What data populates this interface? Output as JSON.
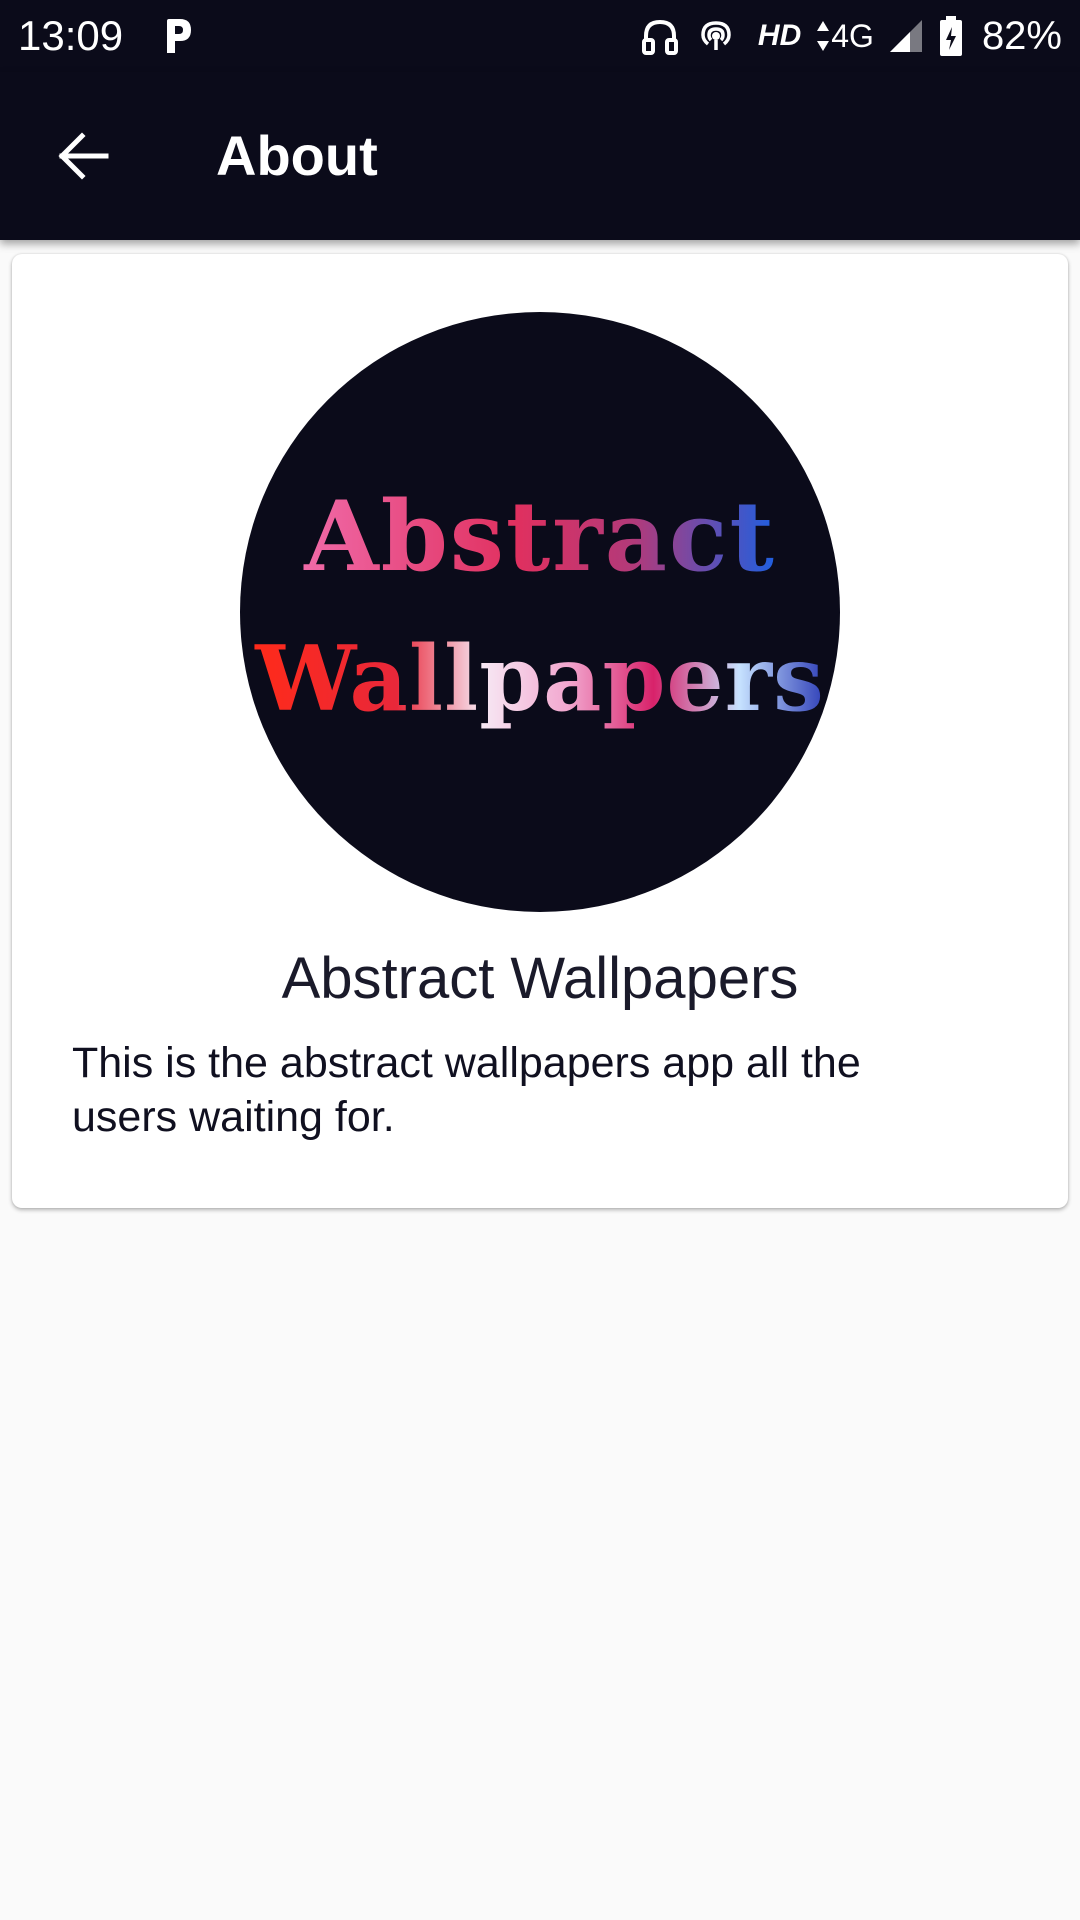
{
  "status_bar": {
    "time": "13:09",
    "network_hd": "HD",
    "network_type": "4G",
    "battery_percent": "82%",
    "icons": [
      "p-notification-icon",
      "headphones-icon",
      "hotspot-icon",
      "data-arrows-icon",
      "signal-icon",
      "battery-charging-icon"
    ]
  },
  "app_bar": {
    "title": "About",
    "back_icon": "arrow-left-icon",
    "background_color": "#0b0b1a"
  },
  "card": {
    "logo": {
      "line1": "Abstract",
      "line2": "Wallpapers",
      "background_color": "#0b0b1a"
    },
    "title": "Abstract Wallpapers",
    "description": "This is the abstract wallpapers app all the users waiting for."
  }
}
